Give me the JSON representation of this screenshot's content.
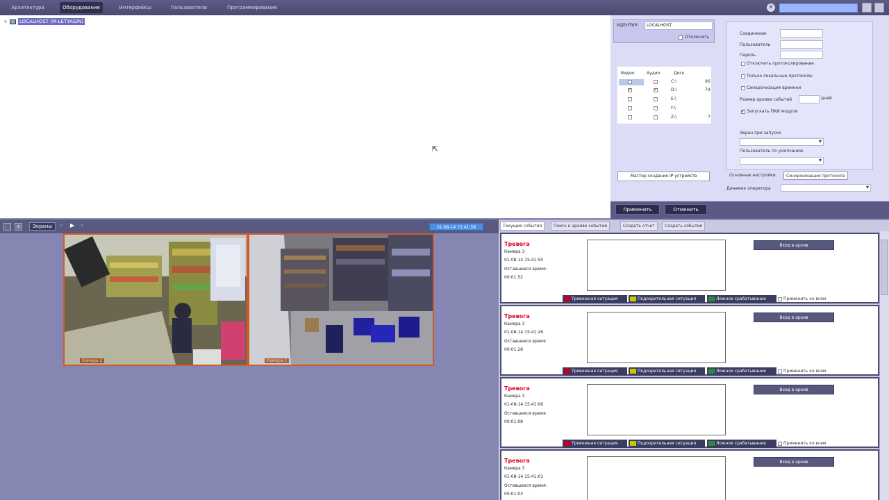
{
  "menu": {
    "tabs": [
      "Архитектура",
      "Оборудование",
      "Интерфейсы",
      "Пользователи",
      "Программирование"
    ],
    "active_tab": "Оборудование"
  },
  "tree": {
    "root_label": "LOCALHOST (M-LETYAGIN)"
  },
  "settings": {
    "id_label": "ИДЕНТИЯ",
    "id_value": "LOCALHOST",
    "disable_label": "Отключить",
    "disk_headers": {
      "video": "Видео",
      "audio": "Аудио",
      "disk": "Диск"
    },
    "disks": [
      {
        "name": "C:\\",
        "extra": "96",
        "video": false,
        "audio": false
      },
      {
        "name": "D:\\",
        "extra": "79",
        "video": true,
        "audio": true
      },
      {
        "name": "E:\\",
        "extra": "",
        "video": false,
        "audio": false
      },
      {
        "name": "F:\\",
        "extra": "",
        "video": false,
        "audio": false
      },
      {
        "name": "Z:\\",
        "extra": "7",
        "video": false,
        "audio": false
      }
    ],
    "ip_wizard_button": "Мастер создания IP устройств",
    "connection_label": "Соединение",
    "user_label": "Пользователь",
    "password_label": "Пароль",
    "disable_protocol_label": "Отключить протоколирование",
    "local_protocols_label": "Только локальные протоколы",
    "sync_time_label": "Синхронизация времени",
    "archive_size_label": "Размер архива событий",
    "days_label": "дней",
    "run_all_modules_label": "Запускать ПКИ модули",
    "screen_on_start_label": "Экран при запуске",
    "default_user_label": "Пользователь по умолчанию",
    "tab_main": "Основные настройки",
    "tab_sync": "Синхронизация протокола",
    "operator_label": "Динамик оператора",
    "apply_button": "Применить",
    "cancel_button": "Отменить"
  },
  "video": {
    "screens_button": "Экраны",
    "clock": "01-08-14  15:41:58",
    "cameras": [
      {
        "label": "Камера 2"
      },
      {
        "label": "Камера 1"
      }
    ]
  },
  "events": {
    "tabs": [
      "Текущие события",
      "Поиск в архиве событий",
      "Создать отчет",
      "Создать событие"
    ],
    "active_tab": "Текущие события",
    "list": [
      {
        "title": "Тревога",
        "camera": "Камера 3",
        "datetime": "01-08-14 15:41:50",
        "remaining_label": "Оставшееся время:",
        "remaining": "00:01:52"
      },
      {
        "title": "Тревога",
        "camera": "Камера 3",
        "datetime": "01-08-14 15:41:26",
        "remaining_label": "Оставшееся время:",
        "remaining": "00:01:28"
      },
      {
        "title": "Тревога",
        "camera": "Камера 3",
        "datetime": "01-08-14 15:41:06",
        "remaining_label": "Оставшееся время:",
        "remaining": "00:01:08"
      },
      {
        "title": "Тревога",
        "camera": "Камера 3",
        "datetime": "01-08-14 15:41:01",
        "remaining_label": "Оставшееся время:",
        "remaining": "00:01:03"
      }
    ],
    "archive_button": "Вход в архив",
    "actions": {
      "alarm": "Тревожная ситуация",
      "suspicious": "Подозрительная ситуация",
      "false": "Ложное срабатывание"
    },
    "apply_all": "Применить ко всем",
    "colors": {
      "alarm": "#c0001c",
      "suspicious": "#c8c800",
      "false": "#2e8b3a"
    }
  }
}
